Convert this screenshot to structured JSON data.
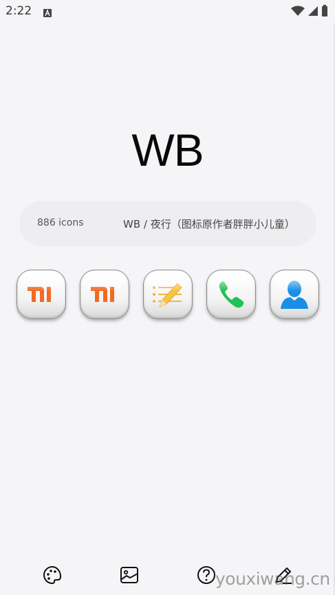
{
  "status_bar": {
    "time": "2:22"
  },
  "header": {
    "title": "WB"
  },
  "info": {
    "icon_count": "886 icons",
    "pack_name": "WB / 夜行（图标原作者胖胖小儿童）"
  },
  "icons": [
    {
      "name": "mi-icon"
    },
    {
      "name": "mi-icon"
    },
    {
      "name": "notes-icon"
    },
    {
      "name": "phone-icon"
    },
    {
      "name": "contacts-icon"
    }
  ],
  "bottom_nav": [
    {
      "icon": "palette-icon"
    },
    {
      "icon": "wallpaper-icon"
    },
    {
      "icon": "help-icon"
    },
    {
      "icon": "edit-icon"
    }
  ],
  "watermark": "youxiwang.cn",
  "colors": {
    "background": "#f5f5f7",
    "mi_orange": "#f26a21",
    "phone_green": "#1fc256",
    "contacts_blue": "#1a8fe6",
    "notes_yellow": "#f7c544"
  }
}
